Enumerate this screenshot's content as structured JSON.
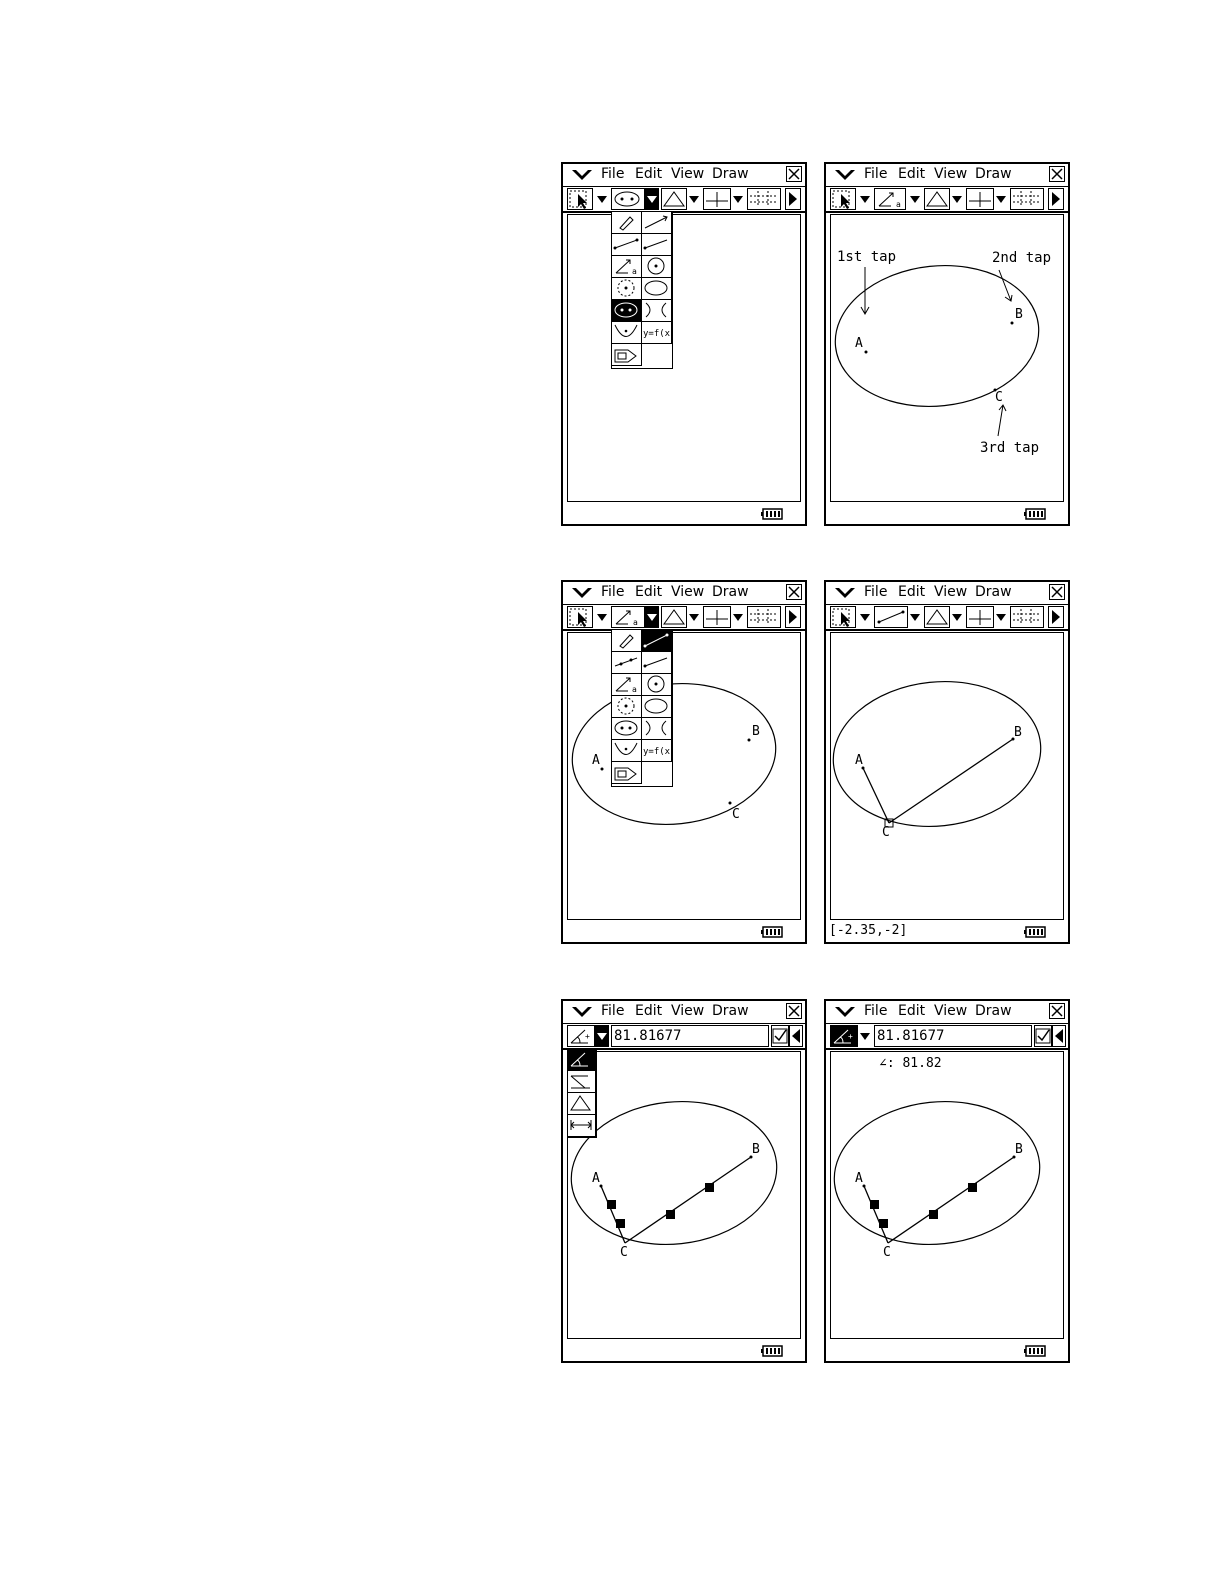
{
  "menu": {
    "file": "File",
    "edit": "Edit",
    "view": "View",
    "draw": "Draw"
  },
  "screens": {
    "s1": {},
    "s2": {
      "label_first_tap": "1st tap",
      "label_second_tap": "2nd tap",
      "label_third_tap": "3rd tap",
      "point_a": "A",
      "point_b": "B",
      "point_c": "C"
    },
    "s3": {
      "point_a": "A",
      "point_b": "B",
      "point_c": "C",
      "yfx_label": "y=f(x)"
    },
    "s4": {
      "point_a": "A",
      "point_b": "B",
      "point_c": "C",
      "status_coords": "[-2.35,-2]"
    },
    "s5": {
      "measure_value": "81.81677",
      "point_a": "A",
      "point_b": "B",
      "point_c": "C"
    },
    "s6": {
      "measure_value": "81.81677",
      "angle_readout": "∠: 81.82",
      "point_a": "A",
      "point_b": "B",
      "point_c": "C"
    }
  },
  "yfx_label": "y=f(x)",
  "icons": [
    "menu-chevron-icon",
    "close-icon",
    "select-arrow-icon",
    "ellipse-icon",
    "triangle-icon",
    "perpendicular-icon",
    "grid-icon",
    "battery-icon",
    "angle-measure-icon",
    "checkbox-icon",
    "pencil-icon",
    "segment-icon",
    "ray-icon",
    "circle-icon",
    "arc-icon"
  ]
}
